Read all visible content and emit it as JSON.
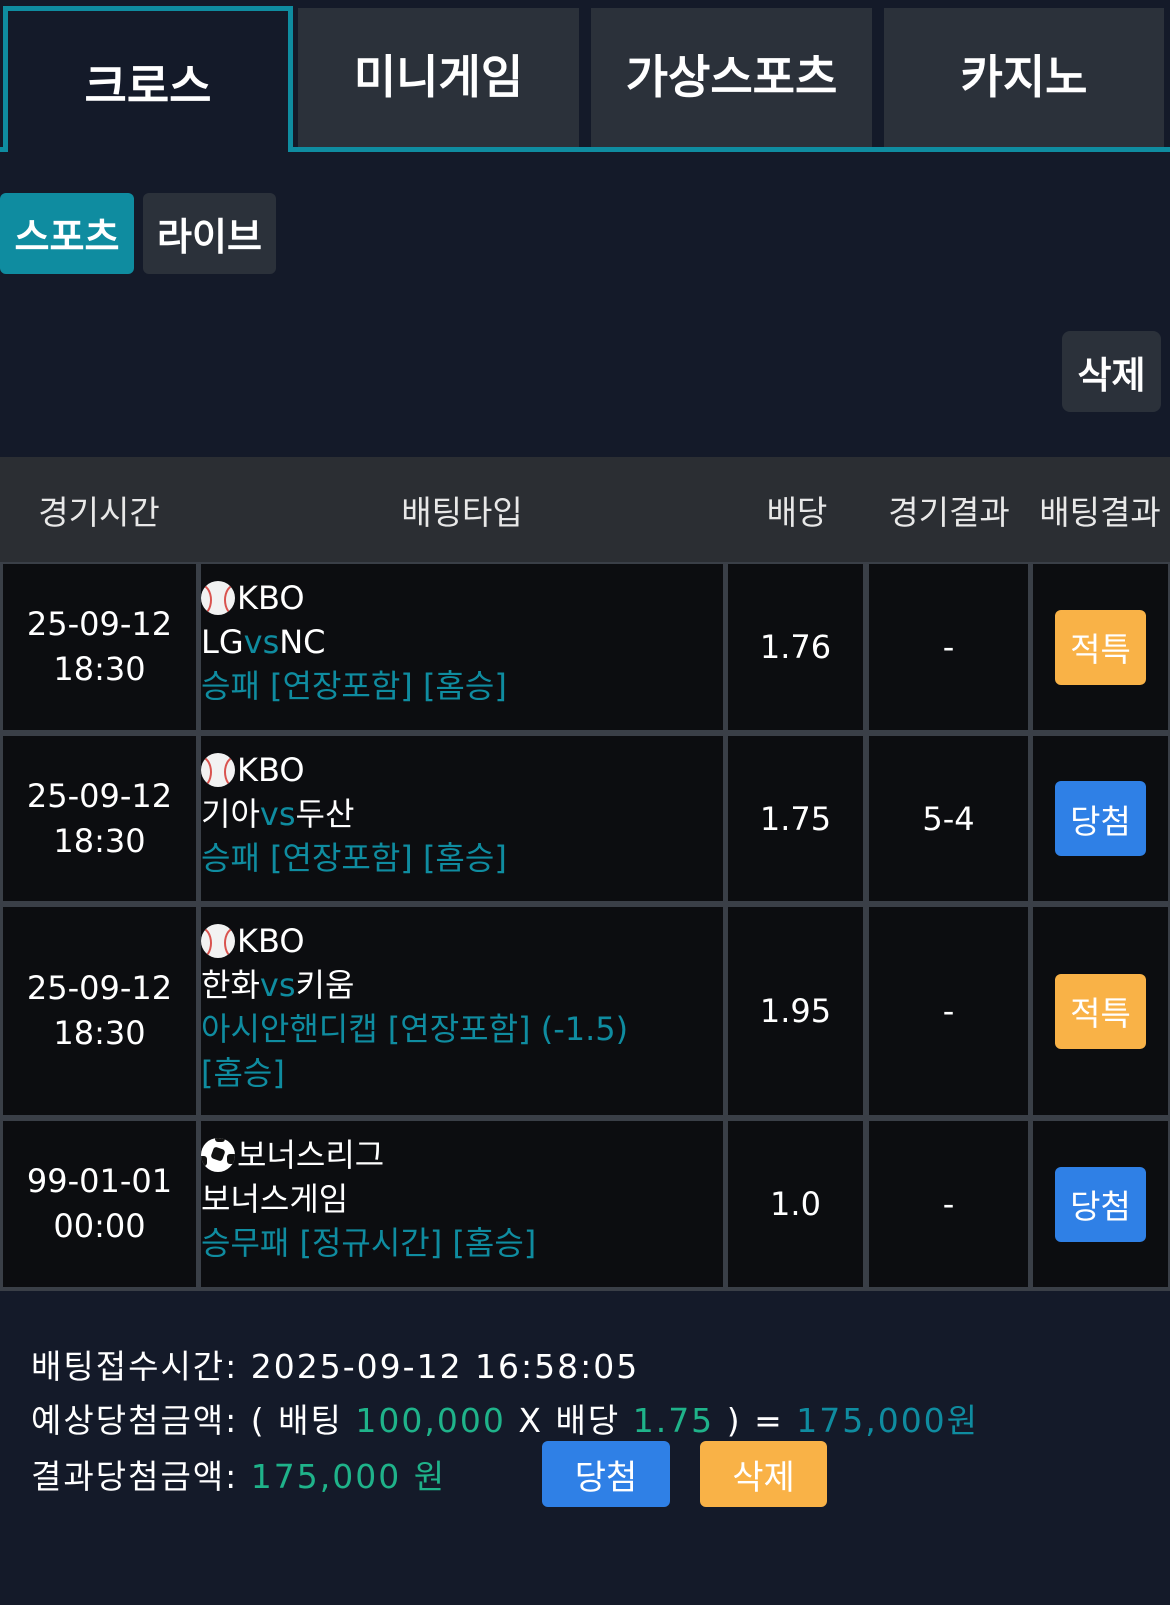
{
  "top_tabs": [
    {
      "label": "크로스",
      "active": true
    },
    {
      "label": "미니게임",
      "active": false
    },
    {
      "label": "가상스포츠",
      "active": false
    },
    {
      "label": "카지노",
      "active": false
    }
  ],
  "sub_tabs": [
    {
      "label": "스포츠",
      "active": true
    },
    {
      "label": "라이브",
      "active": false
    }
  ],
  "delete_label": "삭제",
  "table": {
    "headers": [
      "경기시간",
      "배팅타입",
      "배당",
      "경기결과",
      "배팅결과"
    ],
    "rows": [
      {
        "date": "25-09-12",
        "time": "18:30",
        "sport_icon": "baseball-icon",
        "league": "KBO",
        "home": "LG",
        "vs": "vs",
        "away": "NC",
        "pick": "승패 [연장포함] [홈승]",
        "odds": "1.76",
        "score": "-",
        "result": "적특",
        "result_color": "#f9b247"
      },
      {
        "date": "25-09-12",
        "time": "18:30",
        "sport_icon": "baseball-icon",
        "league": "KBO",
        "home": "기아",
        "vs": "vs",
        "away": "두산",
        "pick": "승패 [연장포함] [홈승]",
        "odds": "1.75",
        "score": "5-4",
        "result": "당첨",
        "result_color": "#2f80e6"
      },
      {
        "date": "25-09-12",
        "time": "18:30",
        "sport_icon": "baseball-icon",
        "league": "KBO",
        "home": "한화",
        "vs": "vs",
        "away": "키움",
        "pick": "아시안핸디캡 [연장포함] (-1.5) [홈승]",
        "odds": "1.95",
        "score": "-",
        "result": "적특",
        "result_color": "#f9b247"
      },
      {
        "date": "99-01-01",
        "time": "00:00",
        "sport_icon": "soccer-ball-icon",
        "league": "보너스리그",
        "match": "보너스게임",
        "pick": "승무패 [정규시간] [홈승]",
        "odds": "1.0",
        "score": "-",
        "result": "당첨",
        "result_color": "#2f80e6"
      }
    ]
  },
  "summary": {
    "bet_time_label": "배팅접수시간:",
    "bet_time_value": "2025-09-12 16:58:05",
    "expected_label": "예상당첨금액:",
    "open_paren": "(",
    "bet_label": "배팅",
    "bet_amount": "100,000",
    "multiply": "X",
    "odds_label": "배당",
    "total_odds": "1.75",
    "close_paren": ")",
    "equals": "=",
    "expected_amount": "175,000원",
    "result_label": "결과당첨금액:",
    "result_amount": "175,000 원",
    "win_button": "당첨",
    "delete_button": "삭제"
  },
  "colors": {
    "accent": "#0f8ca0",
    "win": "#2f80e6",
    "special": "#f9b247",
    "amount_green": "#1fb38a",
    "background": "#141a29"
  }
}
